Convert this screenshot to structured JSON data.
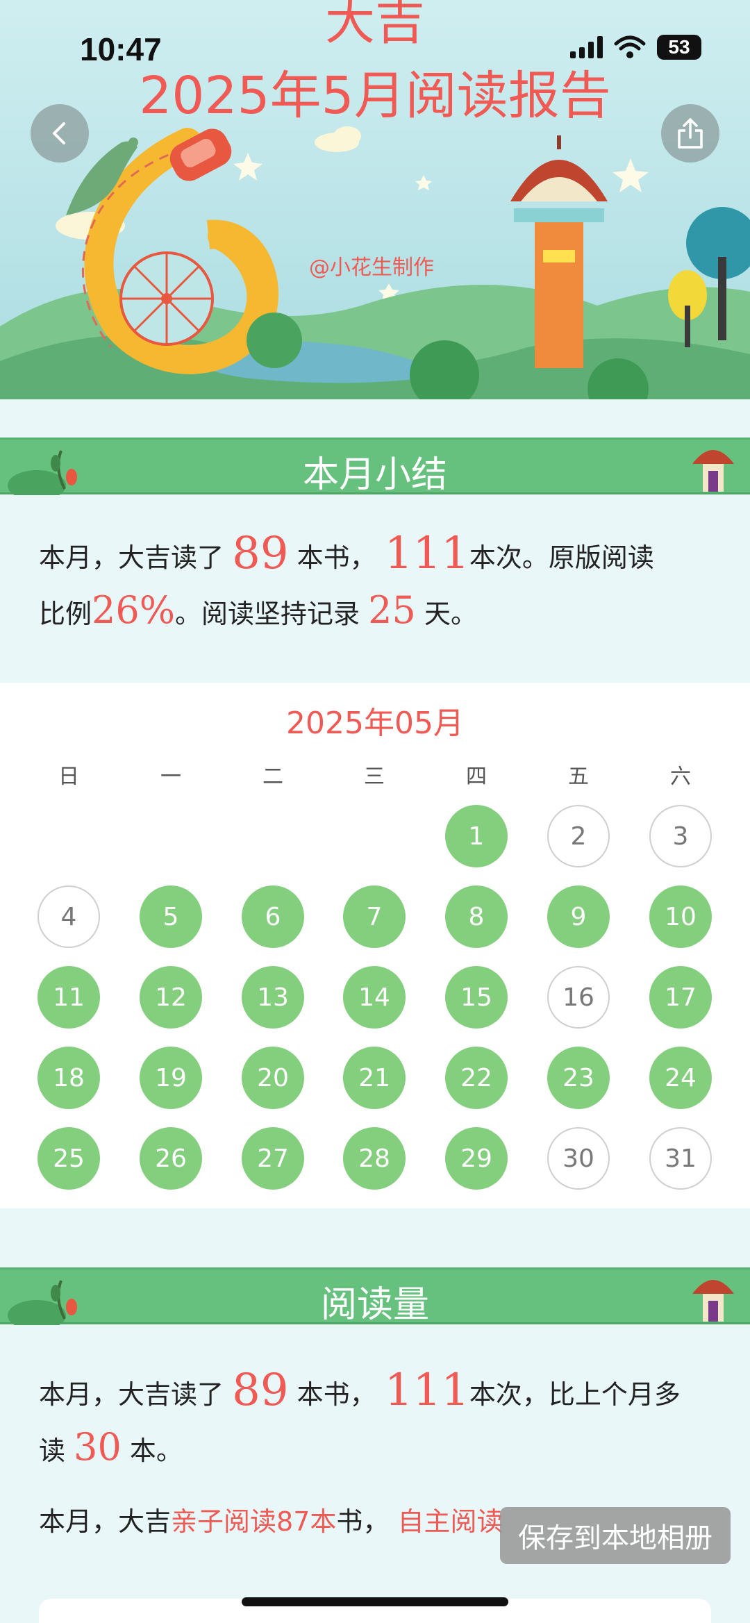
{
  "status_bar": {
    "time": "10:47",
    "battery": "53"
  },
  "banner": {
    "name": "大吉",
    "report_title": "2025年5月阅读报告",
    "credit": "@小花生制作"
  },
  "summary": {
    "header": "本月小结",
    "p1": "本月，大吉读了",
    "books": "89",
    "p2": "本书，",
    "times": "111",
    "p3": "本次。原版阅读",
    "p4": "比例",
    "ratio": "26%",
    "p5": "。阅读坚持记录",
    "streak": "25",
    "p6": "天。"
  },
  "calendar": {
    "title": "2025年05月",
    "weekdays": [
      "日",
      "一",
      "二",
      "三",
      "四",
      "五",
      "六"
    ],
    "first_weekday": 4,
    "days": [
      {
        "d": "1",
        "read": true
      },
      {
        "d": "2",
        "read": false
      },
      {
        "d": "3",
        "read": false
      },
      {
        "d": "4",
        "read": false
      },
      {
        "d": "5",
        "read": true
      },
      {
        "d": "6",
        "read": true
      },
      {
        "d": "7",
        "read": true
      },
      {
        "d": "8",
        "read": true
      },
      {
        "d": "9",
        "read": true
      },
      {
        "d": "10",
        "read": true
      },
      {
        "d": "11",
        "read": true
      },
      {
        "d": "12",
        "read": true
      },
      {
        "d": "13",
        "read": true
      },
      {
        "d": "14",
        "read": true
      },
      {
        "d": "15",
        "read": true
      },
      {
        "d": "16",
        "read": false
      },
      {
        "d": "17",
        "read": true
      },
      {
        "d": "18",
        "read": true
      },
      {
        "d": "19",
        "read": true
      },
      {
        "d": "20",
        "read": true
      },
      {
        "d": "21",
        "read": true
      },
      {
        "d": "22",
        "read": true
      },
      {
        "d": "23",
        "read": true
      },
      {
        "d": "24",
        "read": true
      },
      {
        "d": "25",
        "read": true
      },
      {
        "d": "26",
        "read": true
      },
      {
        "d": "27",
        "read": true
      },
      {
        "d": "28",
        "read": true
      },
      {
        "d": "29",
        "read": true
      },
      {
        "d": "30",
        "read": false
      },
      {
        "d": "31",
        "read": false
      }
    ]
  },
  "volume": {
    "header": "阅读量",
    "p1": "本月，大吉读了",
    "books": "89",
    "p2": "本书，",
    "times": "111",
    "p3": "本次，比上个月多",
    "p4": "读",
    "more": "30",
    "p5": "本。",
    "q1": "本月，大吉",
    "parent_child": "亲子阅读87本",
    "q2": "书，",
    "self": "自主阅读"
  },
  "save_button": "保存到本地相册",
  "icons": {
    "back": "chevron-left-icon",
    "share": "share-icon"
  },
  "colors": {
    "accent_red": "#ef5a55",
    "header_green": "#66c17e",
    "read_day": "#83cf7e"
  }
}
